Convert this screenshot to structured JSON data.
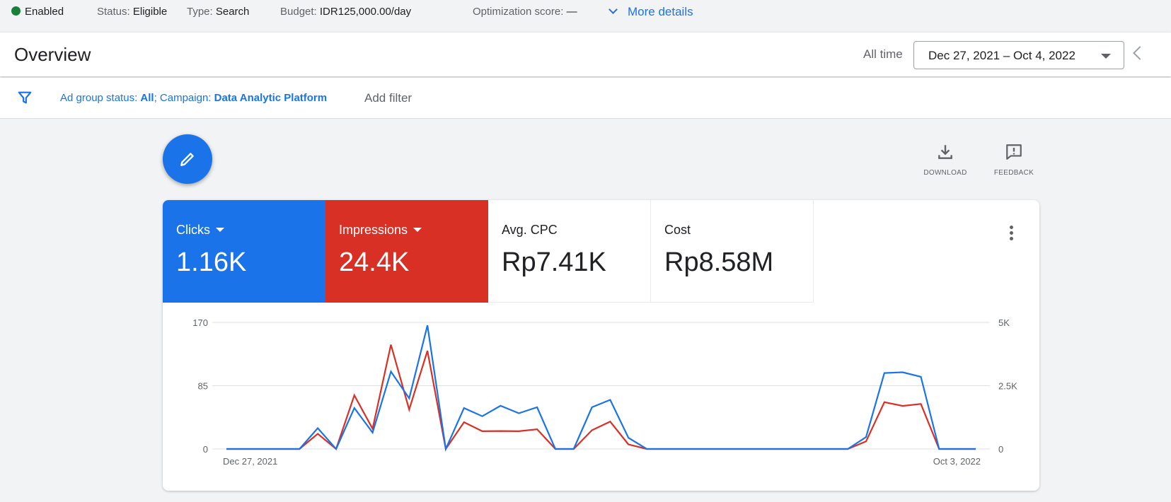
{
  "status": {
    "enabled_label": "Enabled",
    "status_key": "Status:",
    "status_value": "Eligible",
    "type_key": "Type:",
    "type_value": "Search",
    "budget_key": "Budget:",
    "budget_value": "IDR125,000.00/day",
    "opt_key": "Optimization score:",
    "opt_value": "—",
    "more_details": "More details"
  },
  "header": {
    "title": "Overview",
    "range_label": "All time",
    "date_range": "Dec 27, 2021 – Oct 4, 2022"
  },
  "filter": {
    "k1": "Ad group status: ",
    "v1": "All",
    "k2": "; Campaign: ",
    "v2": "Data Analytic Platform",
    "add_filter": "Add filter"
  },
  "actions": {
    "download": "DOWNLOAD",
    "feedback": "FEEDBACK"
  },
  "metrics": [
    {
      "name": "Clicks",
      "value": "1.16K"
    },
    {
      "name": "Impressions",
      "value": "24.4K"
    },
    {
      "name": "Avg. CPC",
      "value": "Rp7.41K"
    },
    {
      "name": "Cost",
      "value": "Rp8.58M"
    }
  ],
  "colors": {
    "clicks": "#1a73e8",
    "impressions": "#d93025",
    "grid": "#e0e0e0",
    "axis_text": "#5f6368"
  },
  "chart_data": {
    "type": "line",
    "x_start_label": "Dec 27, 2021",
    "x_end_label": "Oct 3, 2022",
    "y_left": {
      "ticks": [
        "170",
        "85",
        "0"
      ],
      "ylim": [
        0,
        170
      ]
    },
    "y_right": {
      "ticks": [
        "5K",
        "2.5K",
        "0"
      ],
      "ylim": [
        0,
        5000
      ]
    },
    "grid": true,
    "series": [
      {
        "metric": "Clicks",
        "axis": "left",
        "values": [
          0,
          0,
          0,
          0,
          0,
          28,
          0,
          55,
          22,
          104,
          68,
          166,
          0,
          55,
          44,
          58,
          48,
          56,
          0,
          0,
          56,
          66,
          15,
          0,
          0,
          0,
          0,
          0,
          0,
          0,
          0,
          0,
          0,
          0,
          0,
          16,
          102,
          103,
          97,
          0,
          0,
          0
        ]
      },
      {
        "metric": "Impressions",
        "axis": "right",
        "values": [
          0,
          0,
          0,
          0,
          0,
          600,
          0,
          2120,
          800,
          4120,
          1560,
          3880,
          0,
          1060,
          700,
          710,
          700,
          780,
          0,
          0,
          740,
          1080,
          180,
          0,
          0,
          0,
          0,
          0,
          0,
          0,
          0,
          0,
          0,
          0,
          0,
          300,
          1850,
          1700,
          1780,
          0,
          0,
          0
        ]
      }
    ]
  }
}
